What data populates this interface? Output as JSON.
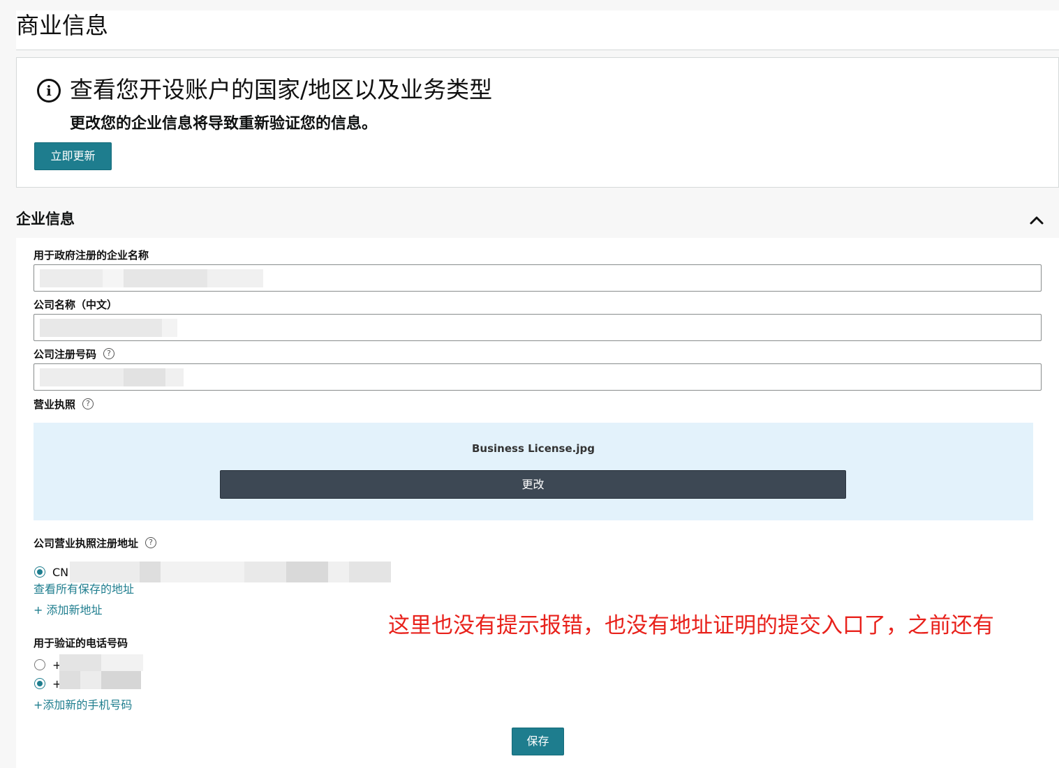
{
  "page": {
    "title": "商业信息"
  },
  "notice": {
    "heading": "查看您开设账户的国家/地区以及业务类型",
    "subtext": "更改您的企业信息将导致重新验证您的信息。",
    "update_button": "立即更新",
    "info_glyph": "i"
  },
  "section": {
    "title": "企业信息"
  },
  "fields": {
    "gov_name_label": "用于政府注册的企业名称",
    "company_name_cn_label": "公司名称（中文）",
    "reg_number_label": "公司注册号码",
    "business_license_label": "营业执照",
    "help_glyph": "?"
  },
  "license": {
    "file_name": "Business License.jpg",
    "change_button": "更改"
  },
  "address": {
    "label": "公司营业执照注册地址",
    "prefix": "CN",
    "view_all_link": "查看所有保存的地址",
    "add_new_link": "+ 添加新地址"
  },
  "phone": {
    "label": "用于验证的电话号码",
    "option_prefix": "+",
    "add_new_link": "+添加新的手机号码"
  },
  "save_button": "保存",
  "annotation": "这里也没有提示报错，也没有地址证明的提交入口了，之前还有",
  "colors": {
    "accent": "#1e7d8e",
    "dark_button": "#3d4854",
    "upload_bg": "#e3f2fb",
    "annotation_red": "#e8211b"
  }
}
